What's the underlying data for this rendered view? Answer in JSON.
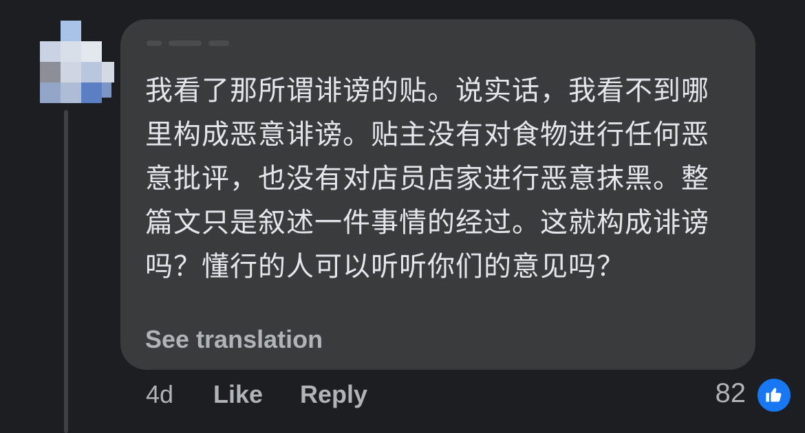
{
  "comment": {
    "text": "我看了那所谓诽谤的贴。说实话，我看不到哪里构成恶意诽谤。贴主没有对食物进行任何恶意批评，也没有对店员店家进行恶意抹黑。整篇文只是叙述一件事情的经过。这就构成诽谤吗？懂行的人可以听听你们的意见吗？",
    "see_translation": "See translation"
  },
  "actions": {
    "time": "4d",
    "like": "Like",
    "reply": "Reply"
  },
  "reactions": {
    "count": "82",
    "icon": "thumbs-up-icon",
    "color": "#1877f2"
  },
  "theme": {
    "background": "#1c1e21",
    "bubble": "#3a3b3c",
    "text": "#e4e6eb",
    "muted": "#b0b3b8"
  }
}
